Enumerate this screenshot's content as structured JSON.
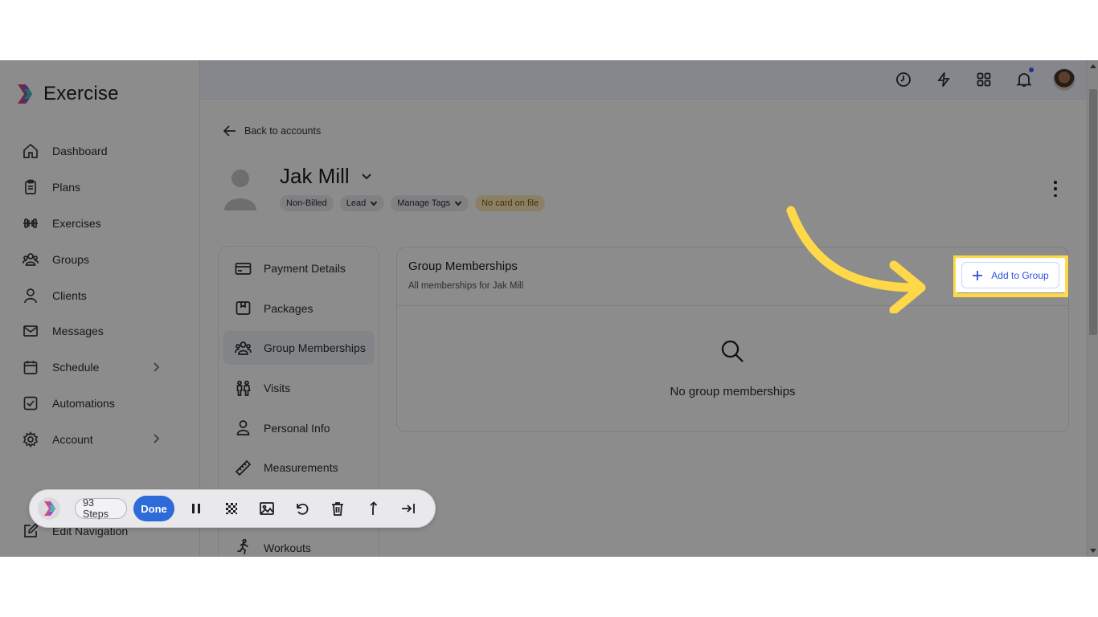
{
  "app": {
    "name": "Exercise"
  },
  "sidebar": {
    "items": [
      {
        "label": "Dashboard",
        "icon": "home-icon"
      },
      {
        "label": "Plans",
        "icon": "clipboard-icon"
      },
      {
        "label": "Exercises",
        "icon": "dumbbell-icon"
      },
      {
        "label": "Groups",
        "icon": "users-icon"
      },
      {
        "label": "Clients",
        "icon": "user-icon"
      },
      {
        "label": "Messages",
        "icon": "mail-icon"
      },
      {
        "label": "Schedule",
        "icon": "calendar-icon",
        "expandable": true
      },
      {
        "label": "Automations",
        "icon": "checkbox-icon"
      },
      {
        "label": "Account",
        "icon": "gear-icon",
        "expandable": true
      }
    ],
    "edit_nav_label": "Edit Navigation"
  },
  "topbar": {
    "icons": [
      "history-icon",
      "bolt-icon",
      "apps-grid-icon",
      "bell-icon",
      "user-avatar"
    ]
  },
  "header": {
    "back_label": "Back to accounts",
    "client_name": "Jak Mill",
    "tags": [
      {
        "label": "Non-Billed",
        "dropdown": false
      },
      {
        "label": "Lead",
        "dropdown": true
      },
      {
        "label": "Manage Tags",
        "dropdown": true
      },
      {
        "label": "No card on file",
        "dropdown": false,
        "style": "warning"
      }
    ]
  },
  "subnav": {
    "items": [
      {
        "label": "Payment Details",
        "icon": "credit-card-icon"
      },
      {
        "label": "Packages",
        "icon": "package-icon"
      },
      {
        "label": "Group Memberships",
        "icon": "group-icon",
        "active": true
      },
      {
        "label": "Visits",
        "icon": "visits-icon"
      },
      {
        "label": "Personal Info",
        "icon": "person-icon"
      },
      {
        "label": "Measurements",
        "icon": "ruler-icon"
      },
      {
        "label": "",
        "icon": "hidden"
      },
      {
        "label": "Workouts",
        "icon": "running-icon"
      }
    ]
  },
  "card": {
    "title": "Group Memberships",
    "subtitle": "All memberships for Jak Mill",
    "add_button": "Add to Group",
    "empty_text": "No group memberships"
  },
  "recorder": {
    "steps": "93 Steps",
    "done": "Done"
  },
  "colors": {
    "accent": "#2f4fe0",
    "highlight": "#ffd84a",
    "done_button": "#2f6bd8",
    "warning_tag_bg": "#fde9b8"
  }
}
